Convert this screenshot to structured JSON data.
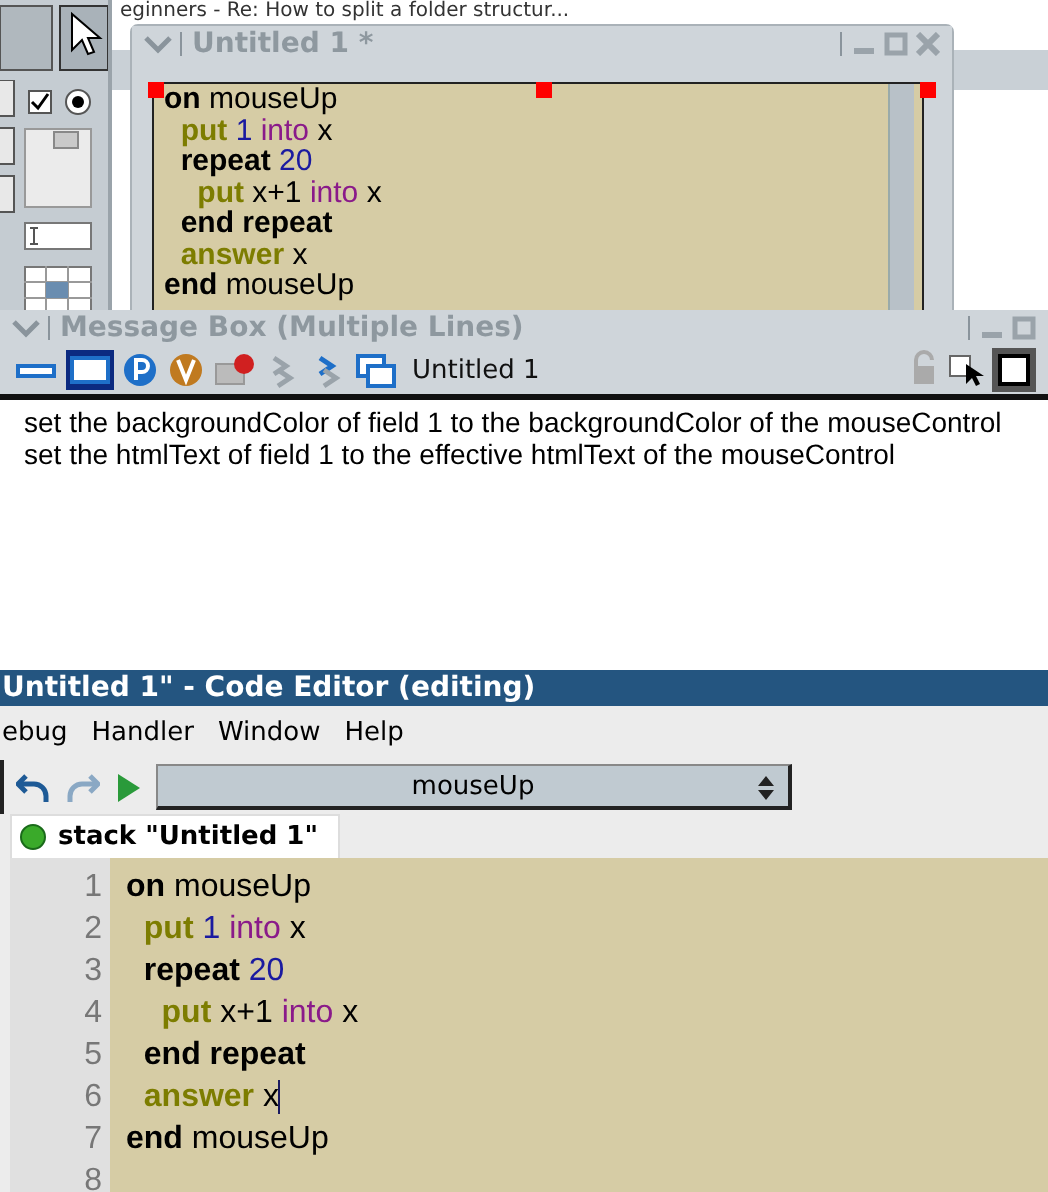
{
  "background_tab": {
    "text": "eginners - Re: How to split a folder structur..."
  },
  "stack_window": {
    "title": "Untitled 1 *",
    "code": [
      {
        "tokens": [
          {
            "kind": "keyword",
            "text": "on"
          },
          {
            "kind": "plain",
            "text": "mouseUp"
          }
        ]
      },
      {
        "tokens": [
          {
            "kind": "command",
            "text": "  put"
          },
          {
            "kind": "number",
            "text": "1"
          },
          {
            "kind": "operator",
            "text": "into"
          },
          {
            "kind": "plain",
            "text": "x"
          }
        ]
      },
      {
        "tokens": [
          {
            "kind": "keyword",
            "text": "  repeat"
          },
          {
            "kind": "number",
            "text": "20"
          }
        ]
      },
      {
        "tokens": [
          {
            "kind": "command",
            "text": "    put"
          },
          {
            "kind": "plain",
            "text": "x+1"
          },
          {
            "kind": "operator",
            "text": "into"
          },
          {
            "kind": "plain",
            "text": "x"
          }
        ]
      },
      {
        "tokens": [
          {
            "kind": "keyword",
            "text": "  end repeat"
          }
        ]
      },
      {
        "tokens": [
          {
            "kind": "command",
            "text": "  answer"
          },
          {
            "kind": "plain",
            "text": "x"
          }
        ]
      },
      {
        "tokens": [
          {
            "kind": "keyword",
            "text": "end"
          },
          {
            "kind": "plain",
            "text": "mouseUp"
          }
        ]
      }
    ]
  },
  "message_box": {
    "title": "Message Box (Multiple Lines)",
    "stack_name": "Untitled 1",
    "lines": [
      "set the backgroundColor of field 1 to the backgroundColor of the mouseControl",
      "set the htmlText of field 1 to the effective htmlText of the mouseControl"
    ]
  },
  "code_editor": {
    "title": "Untitled 1\" - Code Editor (editing)",
    "menu": [
      "ebug",
      "Handler",
      "Window",
      "Help"
    ],
    "handler": "mouseUp",
    "tabs": [
      {
        "label": "stack \"Untitled 1\"",
        "selected": true
      }
    ],
    "line_numbers": [
      "1",
      "2",
      "3",
      "4",
      "5",
      "6",
      "7",
      "8"
    ],
    "code": [
      {
        "cursor": false,
        "tokens": [
          {
            "kind": "keyword",
            "text": "on"
          },
          {
            "kind": "plain",
            "text": "mouseUp"
          }
        ]
      },
      {
        "cursor": false,
        "tokens": [
          {
            "kind": "command",
            "text": "  put"
          },
          {
            "kind": "number",
            "text": "1"
          },
          {
            "kind": "operator",
            "text": "into"
          },
          {
            "kind": "plain",
            "text": "x"
          }
        ]
      },
      {
        "cursor": false,
        "tokens": [
          {
            "kind": "keyword",
            "text": "  repeat"
          },
          {
            "kind": "number",
            "text": "20"
          }
        ]
      },
      {
        "cursor": false,
        "tokens": [
          {
            "kind": "command",
            "text": "    put"
          },
          {
            "kind": "plain",
            "text": "x+1"
          },
          {
            "kind": "operator",
            "text": "into"
          },
          {
            "kind": "plain",
            "text": "x"
          }
        ]
      },
      {
        "cursor": false,
        "tokens": [
          {
            "kind": "keyword",
            "text": "  end repeat"
          }
        ]
      },
      {
        "cursor": true,
        "tokens": [
          {
            "kind": "command",
            "text": "  answer"
          },
          {
            "kind": "plain",
            "text": "x"
          }
        ]
      },
      {
        "cursor": false,
        "tokens": [
          {
            "kind": "keyword",
            "text": "end"
          },
          {
            "kind": "plain",
            "text": "mouseUp"
          }
        ]
      }
    ]
  }
}
